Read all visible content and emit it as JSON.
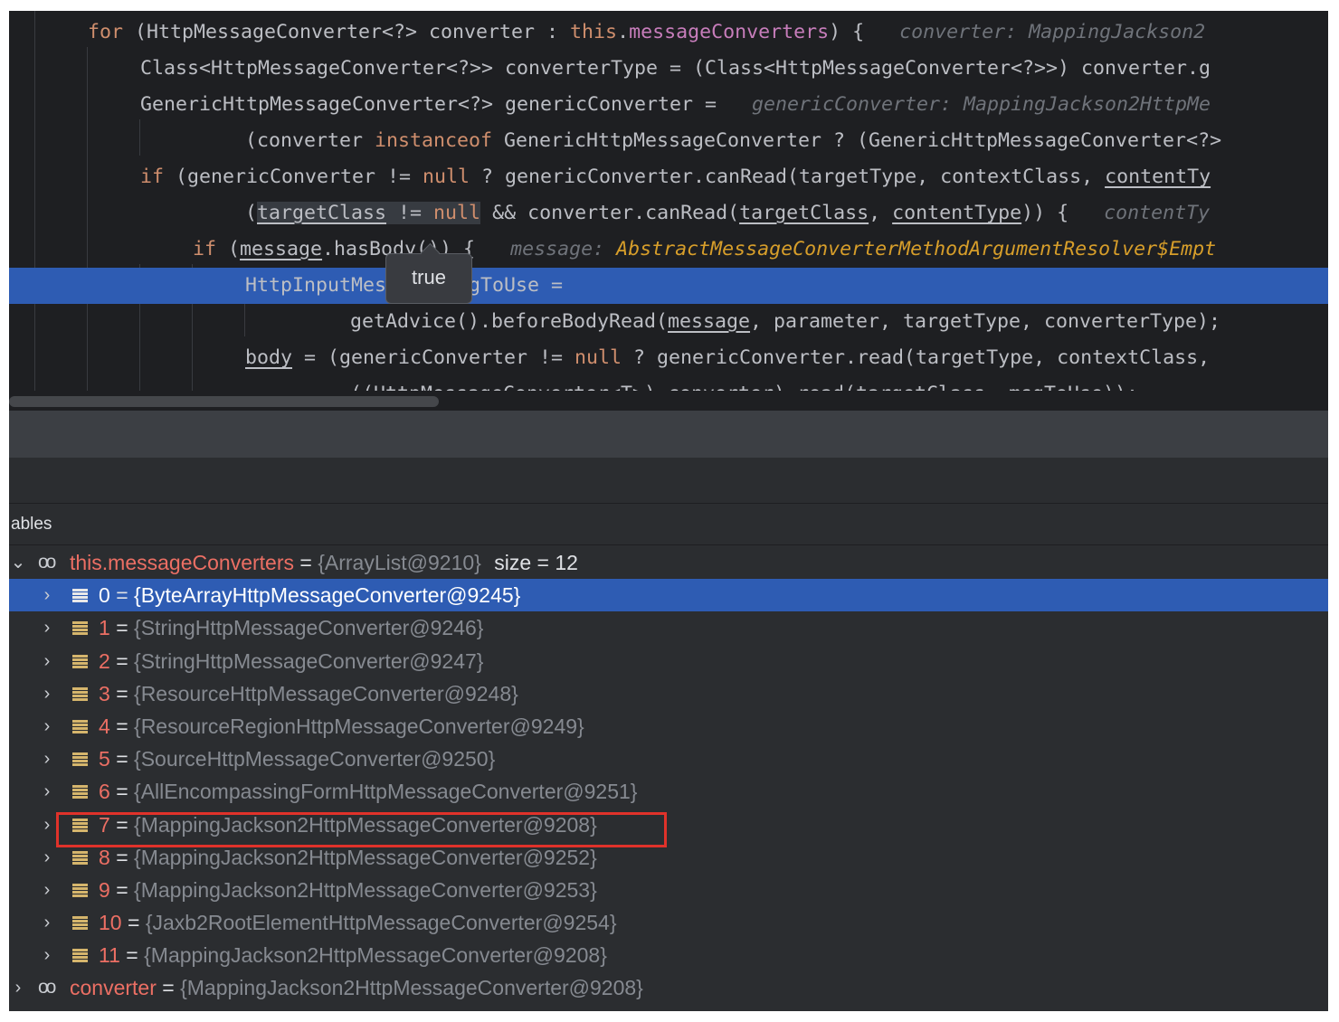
{
  "editor": {
    "lines": [
      {
        "segments": [
          [
            "kw",
            "for "
          ],
          [
            "tp",
            "(HttpMessageConverter<?> converter : "
          ],
          [
            "kw",
            "this"
          ],
          [
            "tp",
            "."
          ],
          [
            "fld",
            "messageConverters"
          ],
          [
            "tp",
            ") {   "
          ],
          [
            "hint",
            "converter: MappingJackson2"
          ]
        ]
      },
      {
        "segments": [
          [
            "tp",
            "Class<HttpMessageConverter<?>> converterType = (Class<HttpMessageConverter<?>>) converter.g"
          ]
        ]
      },
      {
        "segments": [
          [
            "tp",
            "GenericHttpMessageConverter<?> genericConverter =   "
          ],
          [
            "hint",
            "genericConverter: MappingJackson2HttpMe"
          ]
        ]
      },
      {
        "segments": [
          [
            "tp",
            "(converter "
          ],
          [
            "kw",
            "instanceof"
          ],
          [
            "tp",
            " GenericHttpMessageConverter ? (GenericHttpMessageConverter<?>"
          ]
        ]
      },
      {
        "segments": [
          [
            "kw",
            "if"
          ],
          [
            "tp",
            " (genericConverter != "
          ],
          [
            "kw",
            "null"
          ],
          [
            "tp",
            " ? genericConverter.canRead(targetType, contextClass, "
          ],
          [
            "ul",
            "contentTy"
          ]
        ]
      },
      {
        "segments": [
          [
            "tp",
            "("
          ],
          [
            "selul",
            "targetClass"
          ],
          [
            "sel",
            " != "
          ],
          [
            "selkw",
            "null"
          ],
          [
            "tp",
            " && converter.canRead("
          ],
          [
            "ul",
            "targetClass"
          ],
          [
            "tp",
            ", "
          ],
          [
            "ul",
            "contentType"
          ],
          [
            "tp",
            ")) {   "
          ],
          [
            "hint",
            "contentTy"
          ]
        ]
      },
      {
        "segments": [
          [
            "kw",
            "if"
          ],
          [
            "tp",
            " ("
          ],
          [
            "ul",
            "message"
          ],
          [
            "tp",
            ".hasBody()) {   "
          ],
          [
            "hint",
            "message: "
          ],
          [
            "hint-type",
            "AbstractMessageConverterMethodArgumentResolver$Empt"
          ]
        ]
      },
      {
        "segments": [
          [
            "tp",
            "HttpInputMessage msgToUse ="
          ]
        ]
      },
      {
        "segments": [
          [
            "tp",
            "getAdvice().beforeBodyRead("
          ],
          [
            "ul",
            "message"
          ],
          [
            "tp",
            ", parameter, targetType, converterType);"
          ]
        ]
      },
      {
        "segments": [
          [
            "ul",
            "body"
          ],
          [
            "tp",
            " = (genericConverter != "
          ],
          [
            "kw",
            "null"
          ],
          [
            "tp",
            " ? genericConverter.read(targetType, contextClass,"
          ]
        ]
      },
      {
        "segments": [
          [
            "tp",
            "((HttpMessageConverter<T>) converter).read(targetClass, msgToUse));"
          ]
        ]
      }
    ],
    "tooltip": "true"
  },
  "debugger": {
    "panel_title": "ables",
    "root": {
      "name": "this.messageConverters",
      "eq": "=",
      "value": "{ArrayList@9210}",
      "size": "size = 12"
    },
    "items": [
      {
        "index": "0",
        "value": "{ByteArrayHttpMessageConverter@9245}"
      },
      {
        "index": "1",
        "value": "{StringHttpMessageConverter@9246}"
      },
      {
        "index": "2",
        "value": "{StringHttpMessageConverter@9247}"
      },
      {
        "index": "3",
        "value": "{ResourceHttpMessageConverter@9248}"
      },
      {
        "index": "4",
        "value": "{ResourceRegionHttpMessageConverter@9249}"
      },
      {
        "index": "5",
        "value": "{SourceHttpMessageConverter@9250}"
      },
      {
        "index": "6",
        "value": "{AllEncompassingFormHttpMessageConverter@9251}"
      },
      {
        "index": "7",
        "value": "{MappingJackson2HttpMessageConverter@9208}"
      },
      {
        "index": "8",
        "value": "{MappingJackson2HttpMessageConverter@9252}"
      },
      {
        "index": "9",
        "value": "{MappingJackson2HttpMessageConverter@9253}"
      },
      {
        "index": "10",
        "value": "{Jaxb2RootElementHttpMessageConverter@9254}"
      },
      {
        "index": "11",
        "value": "{MappingJackson2HttpMessageConverter@9208}"
      }
    ],
    "converter": {
      "name": "converter",
      "eq": "=",
      "value": "{MappingJackson2HttpMessageConverter@9208}"
    },
    "eq": "="
  },
  "colors": {
    "selection": "#2e5cb3",
    "highlight_box": "#e0322a",
    "keyword": "#cf8e6d",
    "field": "#c77dbb",
    "var_name": "#ec6f64"
  }
}
